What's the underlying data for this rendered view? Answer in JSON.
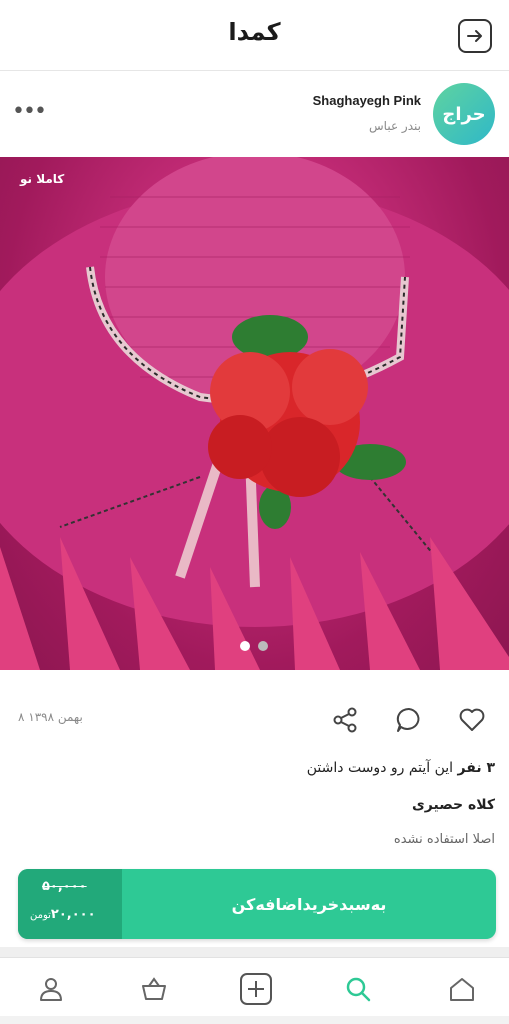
{
  "header": {
    "logo_text": "کمدا",
    "back_icon": "arrow-right-icon"
  },
  "seller": {
    "avatar_text": "حراج",
    "name": "Shaghayegh Pink",
    "city": "بندر عباس",
    "more_icon": "more-dots-icon"
  },
  "photo": {
    "badge": "کاملا نو",
    "slides_total": 2,
    "slide_active": 1
  },
  "actions": {
    "date": "۸ بهمن ۱۳۹۸",
    "like_icon": "heart-icon",
    "comment_icon": "comment-icon",
    "share_icon": "share-icon"
  },
  "item": {
    "likes_count": "۳ نفر",
    "likes_text": "این آیتم رو دوست داشتن",
    "title": "کلاه حصیری",
    "description": "اصلا استفاده نشده"
  },
  "buy": {
    "old_price": "۵۰,۰۰۰",
    "new_price": "۲۰,۰۰۰",
    "currency": "تومن",
    "cta_label": "به‌سبد‌خرید‌اضافه‌کن"
  },
  "nav": {
    "items": [
      "home-icon",
      "search-icon",
      "add-icon",
      "basket-icon",
      "profile-icon"
    ],
    "active": "search-icon",
    "accent": "#2ec995"
  }
}
